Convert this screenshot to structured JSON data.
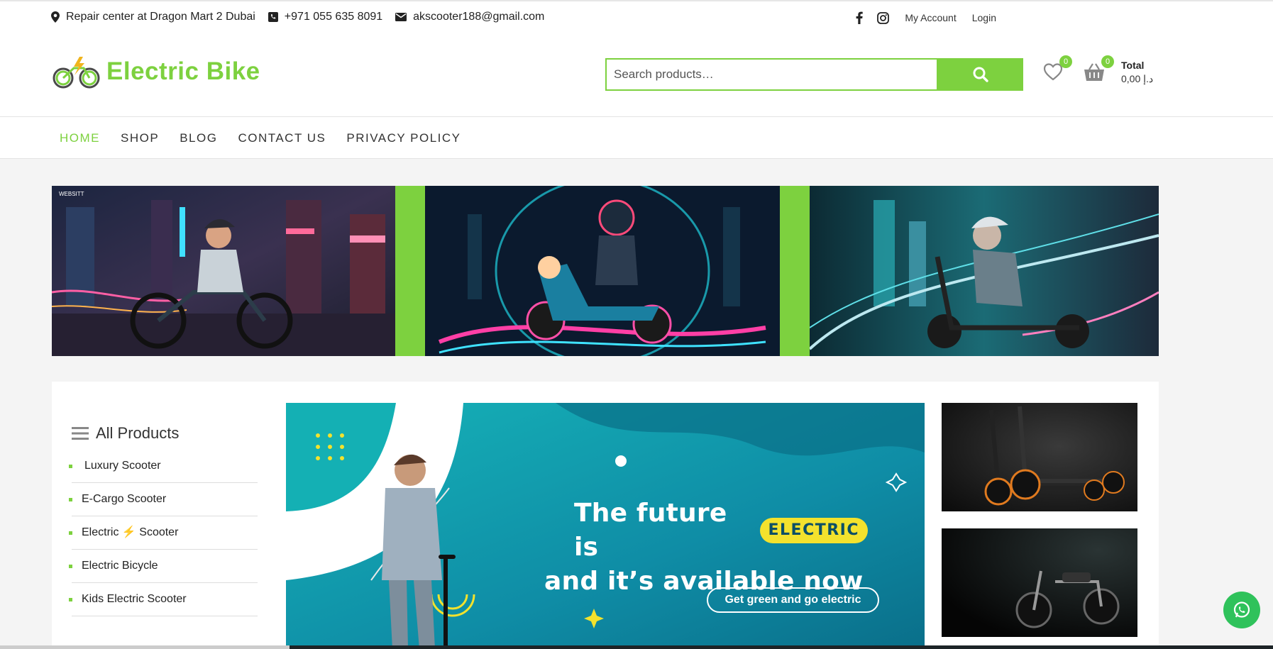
{
  "topbar": {
    "address": "Repair center at Dragon Mart 2 Dubai",
    "phone": "+971 055 635 8091",
    "email": "akscooter188@gmail.com",
    "my_account": "My Account",
    "login": "Login",
    "icons": [
      "map-marker-icon",
      "phone-icon",
      "envelope-icon",
      "facebook-icon",
      "instagram-icon"
    ]
  },
  "header": {
    "logo_text": "Electric Bike",
    "search_placeholder": "Search products…",
    "wishlist_count": "0",
    "cart_count": "0",
    "total_label": "Total",
    "total_value": "0,00 د.إ"
  },
  "nav": {
    "items": [
      {
        "label": "HOME",
        "active": true
      },
      {
        "label": "SHOP",
        "active": false
      },
      {
        "label": "BLOG",
        "active": false
      },
      {
        "label": "CONTACT US",
        "active": false
      },
      {
        "label": "PRIVACY POLICY",
        "active": false
      }
    ]
  },
  "categories": {
    "title": "All Products",
    "items": [
      "Luxury Scooter",
      "E-Cargo Scooter",
      "Electric ⚡ Scooter",
      "Electric Bicycle",
      "Kids Electric Scooter"
    ]
  },
  "promo": {
    "line1": "The future is",
    "highlight": "ELECTRIC",
    "line2": "and it’s available now",
    "cta": "Get green and go electric"
  },
  "banner_mini_logo": "WEBSITT",
  "colors": {
    "accent": "#7dd13f",
    "whatsapp": "#2fc25b",
    "promo_teal": "#0e8fa6",
    "highlight_yellow": "#f3e22d"
  }
}
